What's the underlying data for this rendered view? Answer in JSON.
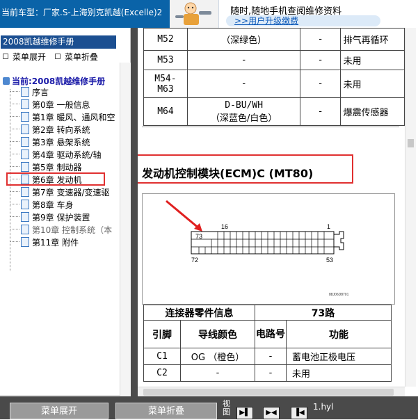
{
  "topbar": {
    "vehicle_label": "当前车型：厂家.S-上海别克凯越(Excelle)2",
    "promo_text": "随时,随地手机查阅维修资料",
    "promo_link": ">>用户升级缴费"
  },
  "sidebar": {
    "manual_title": "2008凯越维修手册",
    "expand_label": "菜单展开",
    "collapse_label": "菜单折叠",
    "current_label": "当前:2008凯越维修手册",
    "items": [
      {
        "label": "序言"
      },
      {
        "label": "第0章 一般信息"
      },
      {
        "label": "第1章 暖风、通风和空"
      },
      {
        "label": "第2章 转向系统"
      },
      {
        "label": "第3章 悬架系统"
      },
      {
        "label": "第4章 驱动系统/轴"
      },
      {
        "label": "第5章 制动器"
      },
      {
        "label": "第6章 发动机"
      },
      {
        "label": "第7章 变速器/变速驱"
      },
      {
        "label": "第8章 车身"
      },
      {
        "label": "第9章 保护装置"
      },
      {
        "label": "第10章 控制系统（本"
      },
      {
        "label": "第11章 附件"
      }
    ],
    "selected_index": 7
  },
  "content": {
    "top_rows": [
      {
        "pin": "M52",
        "color": "（深绿色）",
        "color_code": "",
        "circuit": "-",
        "function": "排气再循环"
      },
      {
        "pin": "M53",
        "color": "-",
        "color_code": "",
        "circuit": "-",
        "function": "未用"
      },
      {
        "pin": "M54-",
        "pin2": "M63",
        "color": "-",
        "color_code": "",
        "circuit": "-",
        "function": "未用"
      },
      {
        "pin": "M64",
        "color_code": "D-BU/WH",
        "color": "（深蓝色/白色）",
        "circuit": "-",
        "function": "爆震传感器"
      }
    ],
    "section_title": "发动机控制模块(ECM)C (MT80)",
    "diagram": {
      "pin_73": "73",
      "pin_16": "16",
      "pin_1": "1",
      "pin_72": "72",
      "pin_53": "53",
      "figure_code": "88J06D8701"
    },
    "info": {
      "header_left": "连接器零件信息",
      "header_right": "73路",
      "col_pin": "引脚",
      "col_color": "导线颜色",
      "col_circuit": "电路号",
      "col_function": "功能",
      "rows": [
        {
          "pin": "C1",
          "color": "OG （橙色）",
          "circuit": "-",
          "function": "蓄电池正极电压"
        },
        {
          "pin": "C2",
          "color": "-",
          "circuit": "-",
          "function": "未用"
        }
      ]
    }
  },
  "bottombar": {
    "expand_label": "菜单展开",
    "collapse_label": "菜单折叠",
    "view_label": "视图",
    "file_label": "1.hyl"
  }
}
